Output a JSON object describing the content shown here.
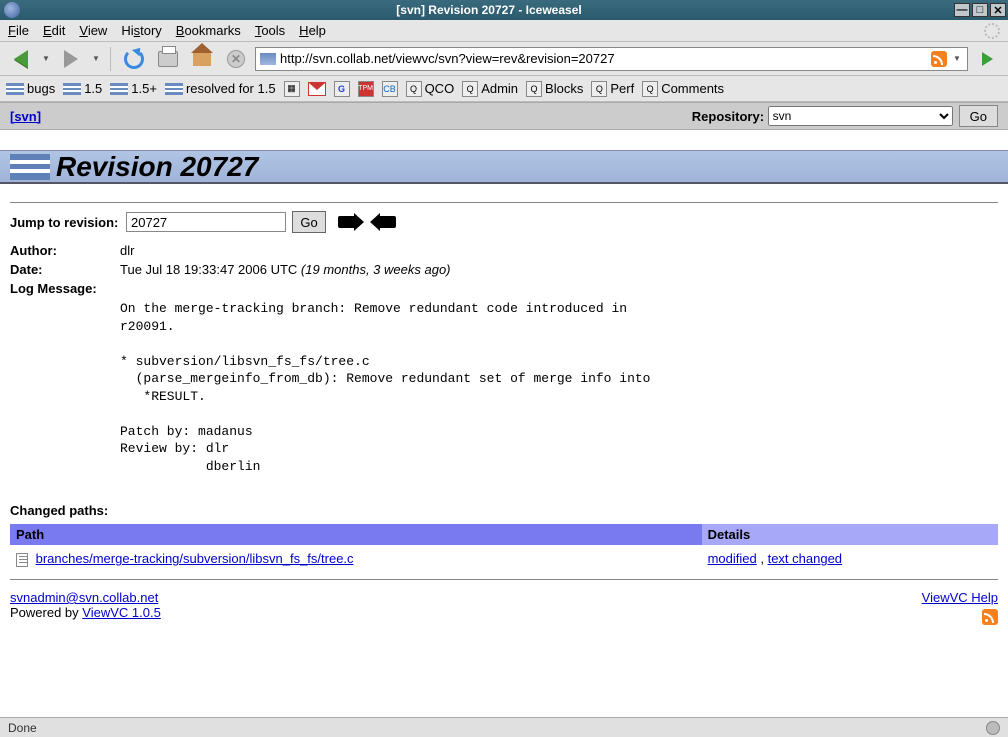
{
  "window": {
    "title": "[svn] Revision 20727 - Iceweasel",
    "minimize": "—",
    "maximize": "□",
    "close": "✕"
  },
  "menubar": {
    "file": "File",
    "edit": "Edit",
    "view": "View",
    "history": "History",
    "bookmarks": "Bookmarks",
    "tools": "Tools",
    "help": "Help"
  },
  "urlbar": {
    "url": "http://svn.collab.net/viewvc/svn?view=rev&revision=20727"
  },
  "bookmarks": {
    "bugs": "bugs",
    "v15": "1.5",
    "v15p": "1.5+",
    "resolved": "resolved for 1.5",
    "qco": "QCO",
    "admin": "Admin",
    "blocks": "Blocks",
    "perf": "Perf",
    "comments": "Comments"
  },
  "repo_strip": {
    "breadcrumb": "[svn]",
    "label": "Repository:",
    "selected": "svn",
    "go": "Go"
  },
  "revision": {
    "heading": "Revision 20727",
    "jump_label": "Jump to revision:",
    "jump_value": "20727",
    "go": "Go",
    "author_label": "Author:",
    "author": "dlr",
    "date_label": "Date:",
    "date": "Tue Jul 18 19:33:47 2006 UTC",
    "ago": "(19 months, 3 weeks ago)",
    "log_label": "Log Message:",
    "log_message": "On the merge-tracking branch: Remove redundant code introduced in\nr20091.\n\n* subversion/libsvn_fs_fs/tree.c\n  (parse_mergeinfo_from_db): Remove redundant set of merge info into\n   *RESULT.\n\nPatch by: madanus\nReview by: dlr\n           dberlin"
  },
  "changed_paths": {
    "heading": "Changed paths:",
    "col_path": "Path",
    "col_details": "Details",
    "rows": [
      {
        "path": "branches/merge-tracking/subversion/libsvn_fs_fs/tree.c",
        "detail_modified": "modified",
        "detail_sep": " , ",
        "detail_text_changed": "text changed"
      }
    ]
  },
  "footer": {
    "admin_email": "svnadmin@svn.collab.net",
    "powered_by": "Powered by ",
    "viewvc": "ViewVC 1.0.5",
    "help": "ViewVC Help"
  },
  "statusbar": {
    "text": "Done"
  }
}
